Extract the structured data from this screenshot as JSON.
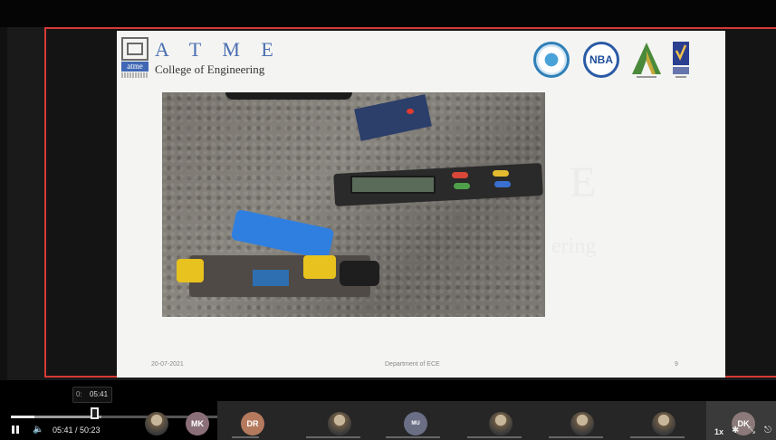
{
  "slide": {
    "logo_text": "atme",
    "college_name": "A T M E",
    "college_subtitle": "College of Engineering",
    "accreditation_badge_2": "NBA",
    "date": "20-07-2021",
    "department": "Department of ECE",
    "page_number": "9",
    "ghost_letter": "E",
    "ghost_text": "ering"
  },
  "player": {
    "hover_time": "05:41",
    "hover_time_cut": "0:",
    "time_readout": "05:41 / 50:23",
    "progress_fraction": 0.113,
    "speed": "1x"
  },
  "participants": [
    {
      "initials": "MK"
    },
    {
      "initials": "DR"
    },
    {
      "initials": "MU"
    },
    {
      "initials": "DK"
    }
  ],
  "icons": {
    "pause": "pause-icon",
    "volume": "volume-icon",
    "settings": "gear-icon",
    "minimize": "minimize-icon",
    "exit": "exit-icon"
  },
  "colors": {
    "share_border": "#d63a35",
    "brand_blue": "#4b6fb2"
  }
}
